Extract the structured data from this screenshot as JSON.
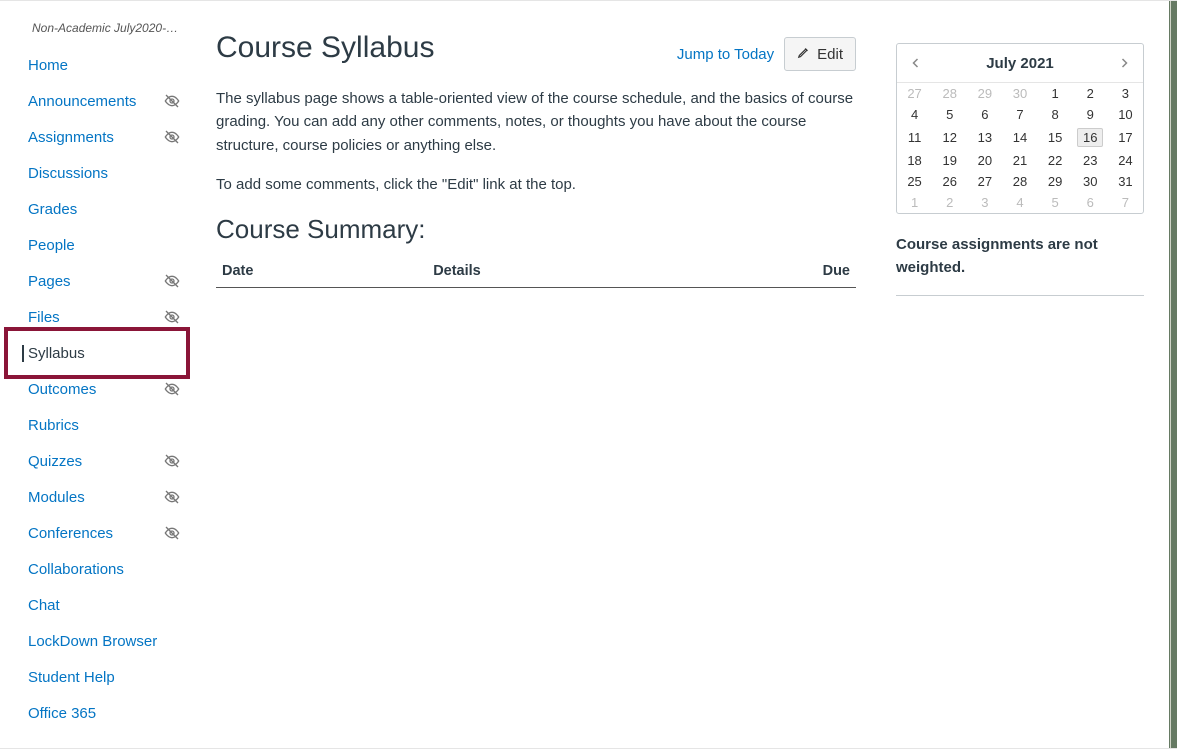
{
  "breadcrumb": "Non-Academic July2020-July…",
  "nav": [
    {
      "label": "Home",
      "hidden": false,
      "active": false
    },
    {
      "label": "Announcements",
      "hidden": true,
      "active": false
    },
    {
      "label": "Assignments",
      "hidden": true,
      "active": false
    },
    {
      "label": "Discussions",
      "hidden": false,
      "active": false
    },
    {
      "label": "Grades",
      "hidden": false,
      "active": false
    },
    {
      "label": "People",
      "hidden": false,
      "active": false
    },
    {
      "label": "Pages",
      "hidden": true,
      "active": false
    },
    {
      "label": "Files",
      "hidden": true,
      "active": false
    },
    {
      "label": "Syllabus",
      "hidden": false,
      "active": true
    },
    {
      "label": "Outcomes",
      "hidden": true,
      "active": false
    },
    {
      "label": "Rubrics",
      "hidden": false,
      "active": false
    },
    {
      "label": "Quizzes",
      "hidden": true,
      "active": false
    },
    {
      "label": "Modules",
      "hidden": true,
      "active": false
    },
    {
      "label": "Conferences",
      "hidden": true,
      "active": false
    },
    {
      "label": "Collaborations",
      "hidden": false,
      "active": false
    },
    {
      "label": "Chat",
      "hidden": false,
      "active": false
    },
    {
      "label": "LockDown Browser",
      "hidden": false,
      "active": false
    },
    {
      "label": "Student Help",
      "hidden": false,
      "active": false
    },
    {
      "label": "Office 365",
      "hidden": false,
      "active": false
    }
  ],
  "content": {
    "title": "Course Syllabus",
    "jump": "Jump to Today",
    "edit": "Edit",
    "para1": "The syllabus page shows a table-oriented view of the course schedule, and the basics of course grading. You can add any other comments, notes, or thoughts you have about the course structure, course policies or anything else.",
    "para2": "To add some comments, click the \"Edit\" link at the top.",
    "summary_title": "Course Summary:",
    "columns": {
      "date": "Date",
      "details": "Details",
      "due": "Due"
    }
  },
  "calendar": {
    "title": "July 2021",
    "weeks": [
      [
        {
          "d": "27",
          "o": true
        },
        {
          "d": "28",
          "o": true
        },
        {
          "d": "29",
          "o": true
        },
        {
          "d": "30",
          "o": true
        },
        {
          "d": "1"
        },
        {
          "d": "2"
        },
        {
          "d": "3"
        }
      ],
      [
        {
          "d": "4"
        },
        {
          "d": "5"
        },
        {
          "d": "6"
        },
        {
          "d": "7"
        },
        {
          "d": "8"
        },
        {
          "d": "9"
        },
        {
          "d": "10"
        }
      ],
      [
        {
          "d": "11"
        },
        {
          "d": "12"
        },
        {
          "d": "13"
        },
        {
          "d": "14"
        },
        {
          "d": "15"
        },
        {
          "d": "16",
          "t": true
        },
        {
          "d": "17"
        }
      ],
      [
        {
          "d": "18"
        },
        {
          "d": "19"
        },
        {
          "d": "20"
        },
        {
          "d": "21"
        },
        {
          "d": "22"
        },
        {
          "d": "23"
        },
        {
          "d": "24"
        }
      ],
      [
        {
          "d": "25"
        },
        {
          "d": "26"
        },
        {
          "d": "27"
        },
        {
          "d": "28"
        },
        {
          "d": "29"
        },
        {
          "d": "30"
        },
        {
          "d": "31"
        }
      ],
      [
        {
          "d": "1",
          "o": true
        },
        {
          "d": "2",
          "o": true
        },
        {
          "d": "3",
          "o": true
        },
        {
          "d": "4",
          "o": true
        },
        {
          "d": "5",
          "o": true
        },
        {
          "d": "6",
          "o": true
        },
        {
          "d": "7",
          "o": true
        }
      ]
    ]
  },
  "weight_note": "Course assignments are not weighted."
}
